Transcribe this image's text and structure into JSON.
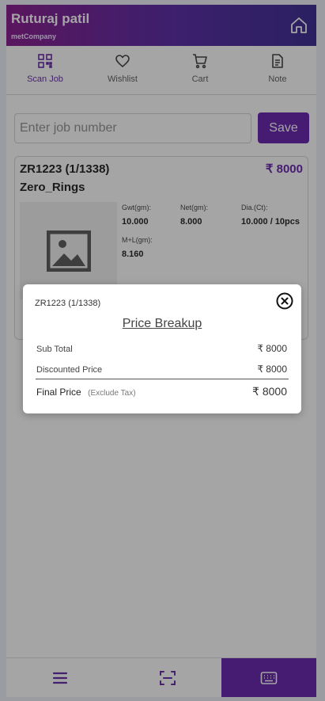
{
  "header": {
    "user_name": "Ruturaj patil",
    "company": "metCompany",
    "home_icon": "home-icon",
    "gradient": [
      "#7e0a86",
      "#2c1a8a"
    ]
  },
  "nav": {
    "active_color": "#5a1aa0",
    "items": [
      {
        "label": "Scan Job",
        "icon": "qr-code-icon",
        "active": true
      },
      {
        "label": "Wishlist",
        "icon": "heart-icon",
        "active": false
      },
      {
        "label": "Cart",
        "icon": "cart-icon",
        "active": false
      },
      {
        "label": "Note",
        "icon": "note-icon",
        "active": false
      }
    ]
  },
  "search": {
    "placeholder": "Enter job number",
    "value": "",
    "save_label": "Save"
  },
  "card": {
    "code": "ZR1223 (1/1338)",
    "price": "₹ 8000",
    "design": "Zero_Rings",
    "image_icon": "image-placeholder-icon",
    "specs": {
      "gwt_label": "Gwt(gm):",
      "gwt_value": "10.000",
      "net_label": "Net(gm):",
      "net_value": "8.000",
      "dia_label": "Dia.(Ct):",
      "dia_value": "10.000 / 10pcs",
      "ml_label": "M+L(gm):",
      "ml_value": "8.160"
    }
  },
  "modal": {
    "code": "ZR1223 (1/1338)",
    "title": "Price Breakup",
    "close_icon": "close-circle-icon",
    "rows": [
      {
        "label": "Sub Total",
        "value": "₹ 8000"
      },
      {
        "label": "Discounted Price",
        "value": "₹ 8000"
      }
    ],
    "final": {
      "label": "Final Price",
      "note": "(Exclude Tax)",
      "value": "₹ 8000"
    }
  },
  "bottom_bar": {
    "items": [
      {
        "icon": "menu-icon",
        "active": false
      },
      {
        "icon": "scan-icon",
        "active": false
      },
      {
        "icon": "keyboard-icon",
        "active": true
      }
    ],
    "active_color": "#5a14a8"
  }
}
